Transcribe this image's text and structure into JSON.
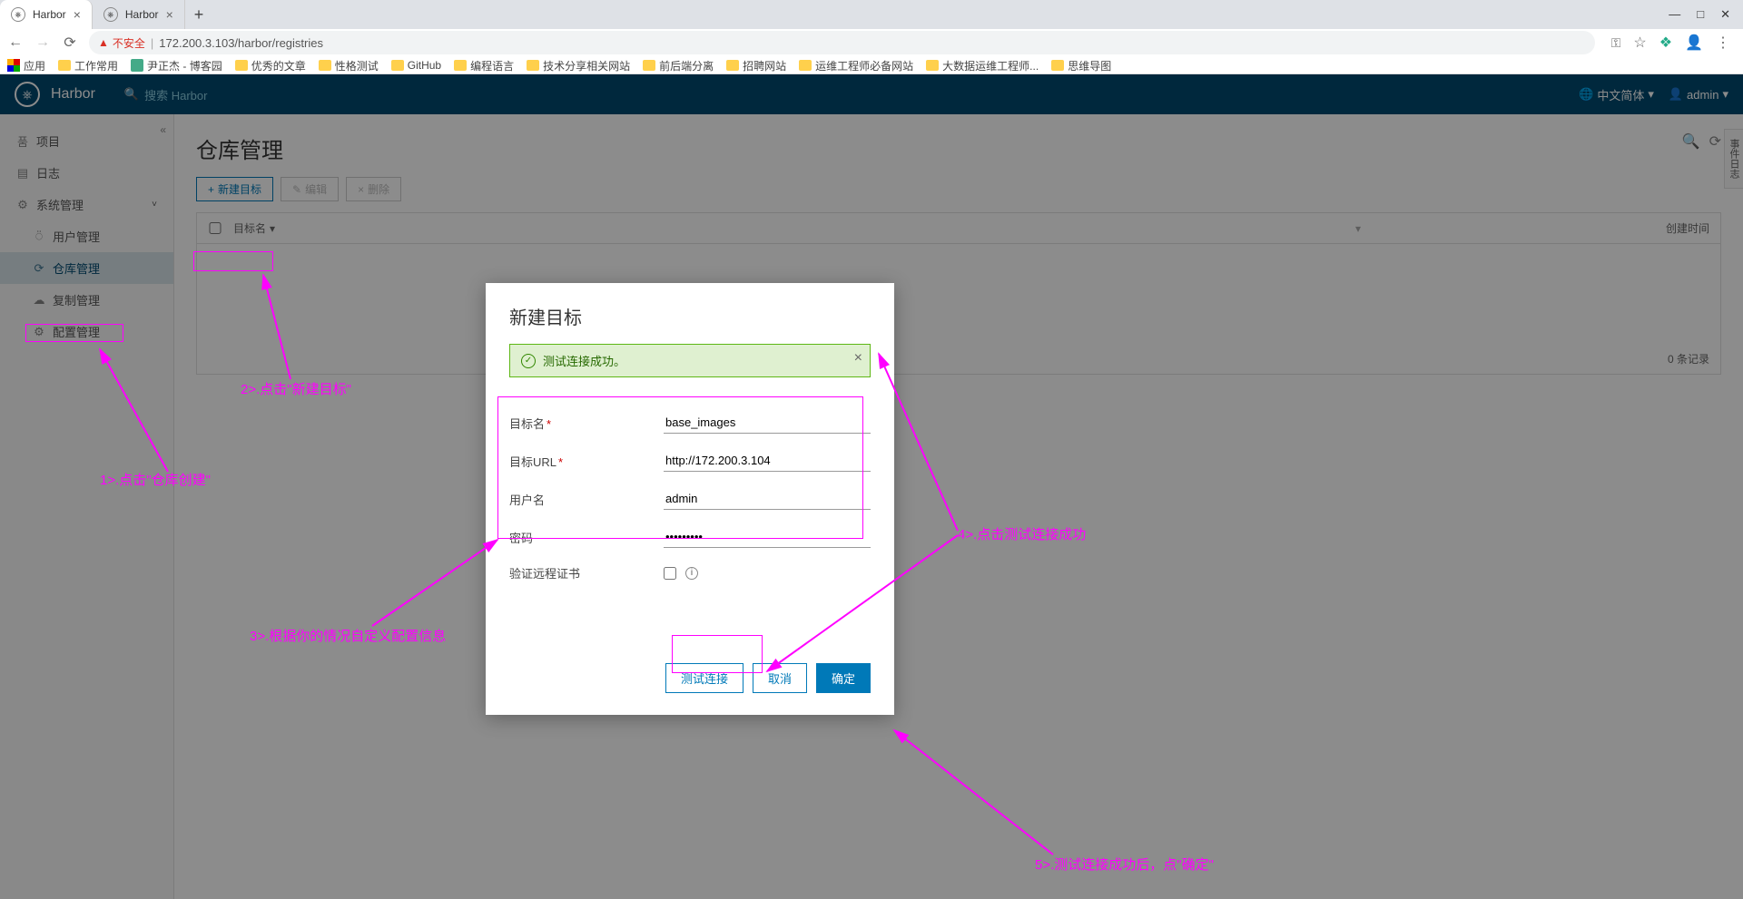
{
  "tabs": [
    {
      "title": "Harbor",
      "active": true
    },
    {
      "title": "Harbor",
      "active": false
    }
  ],
  "window": {
    "min": "—",
    "max": "□",
    "close": "✕"
  },
  "nav": {
    "back": "←",
    "fwd": "→",
    "reload": "⟳"
  },
  "url": {
    "insecure_label": "不安全",
    "sep": "|",
    "text": "172.200.3.103/harbor/registries"
  },
  "addr_icons": {
    "key": "⚿",
    "star": "☆",
    "ext": "❖",
    "user": "👤",
    "more": "⋮"
  },
  "bookmarks": {
    "apps": "应用",
    "items": [
      "工作常用",
      "尹正杰 - 博客园",
      "优秀的文章",
      "性格测试",
      "GitHub",
      "编程语言",
      "技术分享相关网站",
      "前后端分离",
      "招聘网站",
      "运维工程师必备网站",
      "大数据运维工程师...",
      "思维导图"
    ]
  },
  "harbor": {
    "title": "Harbor",
    "search_placeholder": "搜索 Harbor",
    "lang": "中文简体",
    "user": "admin"
  },
  "sidebar": {
    "collapse": "«",
    "items": [
      {
        "icon": "품",
        "label": "项目",
        "sub": false
      },
      {
        "icon": "▤",
        "label": "日志",
        "sub": false
      },
      {
        "icon": "⚙",
        "label": "系统管理",
        "sub": false,
        "chev": "˅"
      },
      {
        "icon": "⍥",
        "label": "用户管理",
        "sub": true
      },
      {
        "icon": "⟳",
        "label": "仓库管理",
        "sub": true,
        "active": true
      },
      {
        "icon": "☁",
        "label": "复制管理",
        "sub": true
      },
      {
        "icon": "⚙",
        "label": "配置管理",
        "sub": true
      }
    ]
  },
  "page": {
    "title": "仓库管理",
    "btn_new": "新建目标",
    "btn_edit": "编辑",
    "btn_del": "删除",
    "col_name": "目标名",
    "col_time": "创建时间",
    "footer": "0 条记录",
    "event_log": "事件日志"
  },
  "modal": {
    "title": "新建目标",
    "alert": "测试连接成功。",
    "labels": {
      "name": "目标名",
      "url": "目标URL",
      "user": "用户名",
      "pass": "密码",
      "verify": "验证远程证书"
    },
    "values": {
      "name": "base_images",
      "url": "http://172.200.3.104",
      "user": "admin",
      "pass": "•••••••••"
    },
    "btn_test": "测试连接",
    "btn_cancel": "取消",
    "btn_ok": "确定"
  },
  "annotations": {
    "a1": "1>.点击\"仓库创建\"",
    "a2": "2>.点击\"新建目标\"",
    "a3": "3>.根据你的情况自定义配置信息",
    "a4": "4>.点击测试连接成功",
    "a5": "5>.测试连接成功后，点\"确定\""
  }
}
